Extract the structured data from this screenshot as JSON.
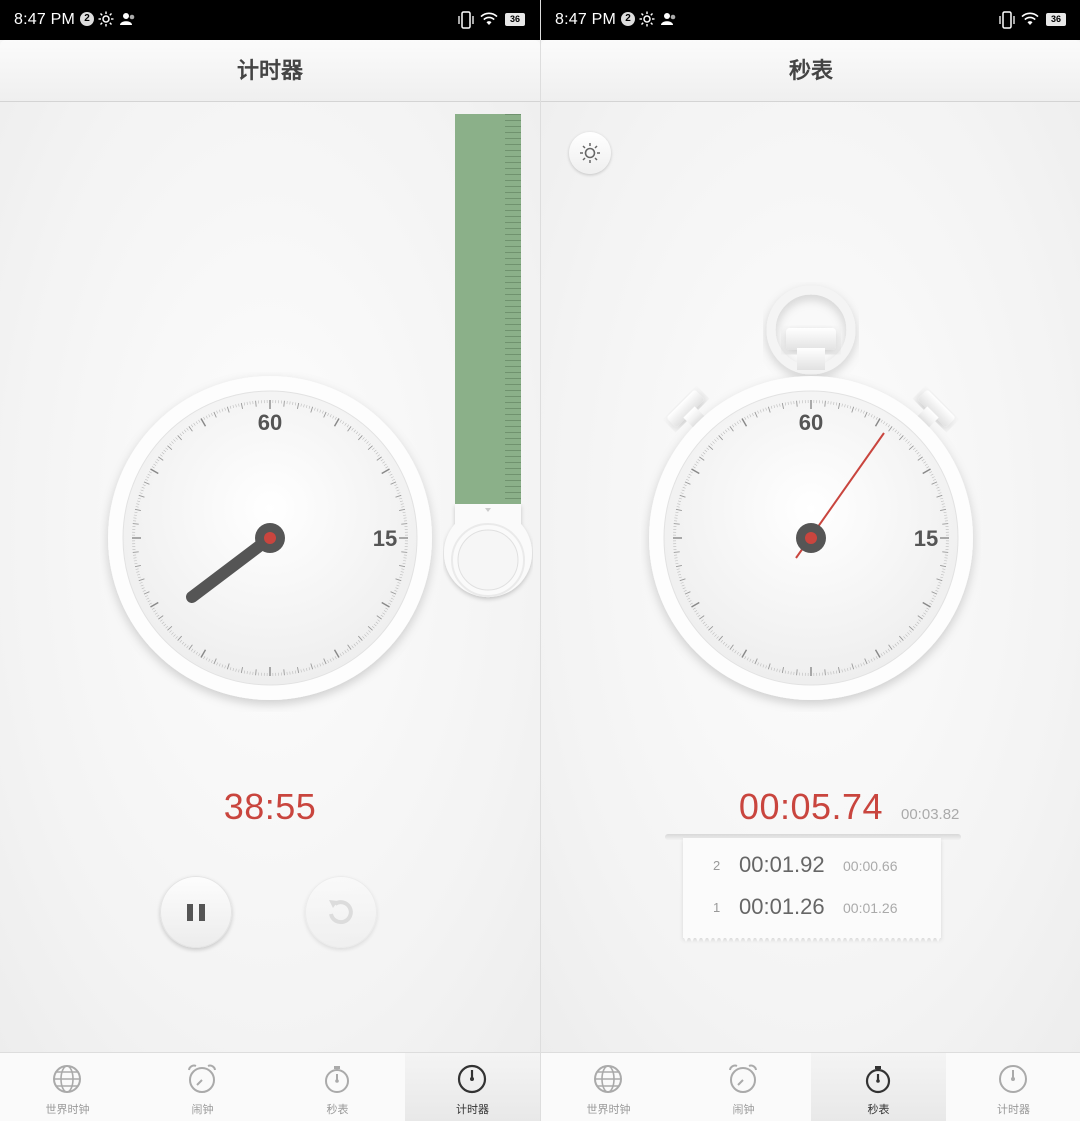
{
  "status_bar": {
    "time": "8:47 PM",
    "notification_count": "2",
    "battery": "36"
  },
  "tabs": [
    "世界时钟",
    "闹钟",
    "秒表",
    "计时器"
  ],
  "timer_screen": {
    "title": "计时器",
    "dial_labels": {
      "top": "60",
      "right": "15"
    },
    "time": "38:55",
    "pause_icon": "pause-icon",
    "reset_icon": "reset-icon",
    "active_tab_index": 3
  },
  "stopwatch_screen": {
    "title": "秒表",
    "dial_labels": {
      "top": "60",
      "right": "15"
    },
    "time": "00:05.74",
    "current_split": "00:03.82",
    "laps": [
      {
        "index": "2",
        "time": "00:01.92",
        "split": "00:00.66"
      },
      {
        "index": "1",
        "time": "00:01.26",
        "split": "00:01.26"
      }
    ],
    "active_tab_index": 2
  },
  "colors": {
    "accent_red": "#c9453e",
    "timer_green": "#8bb089",
    "hand_dark": "#555555"
  },
  "icons": {
    "tab_icons": [
      "globe-icon",
      "alarm-clock-icon",
      "stopwatch-icon",
      "timer-icon"
    ],
    "brightness": "sun-icon"
  }
}
